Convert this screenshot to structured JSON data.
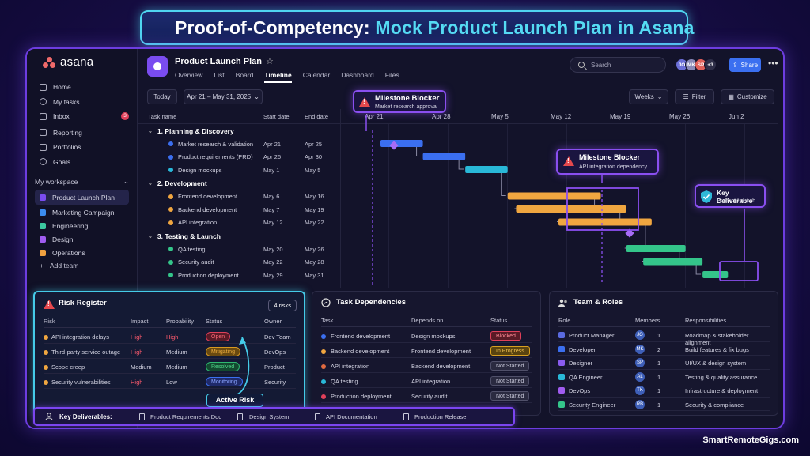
{
  "banner": {
    "title_main": "Proof-of-Competency:",
    "title_accent": "Mock Product Launch Plan in Asana"
  },
  "sidebar": {
    "logo": "asana",
    "nav": [
      {
        "label": "Home",
        "icon": "home-icon"
      },
      {
        "label": "My tasks",
        "icon": "check-icon"
      },
      {
        "label": "Inbox",
        "icon": "bell-icon",
        "badge": "3"
      },
      {
        "label": "Reporting",
        "icon": "chart-icon"
      },
      {
        "label": "Portfolios",
        "icon": "folder-icon"
      },
      {
        "label": "Goals",
        "icon": "target-icon"
      }
    ],
    "workspace_label": "My workspace",
    "projects": [
      {
        "label": "Product Launch Plan",
        "color": "#7a4cf0"
      },
      {
        "label": "Marketing Campaign",
        "color": "#3b8cf0"
      },
      {
        "label": "Engineering",
        "color": "#3cc8a0"
      },
      {
        "label": "Design",
        "color": "#a05cf0"
      },
      {
        "label": "Operations",
        "color": "#f0a040"
      }
    ],
    "add_team": "Add team"
  },
  "header": {
    "project_title": "Product Launch Plan",
    "tabs": [
      "Overview",
      "List",
      "Board",
      "Timeline",
      "Calendar",
      "Dashboard",
      "Files"
    ],
    "active_tab": "Timeline",
    "search_placeholder": "Search",
    "avatars": [
      {
        "initials": "JO",
        "color": "#6b6fd8"
      },
      {
        "initials": "MK",
        "color": "#8a8ab8"
      },
      {
        "initials": "SP",
        "color": "#e0605a"
      }
    ],
    "avatar_more": "+3",
    "share_label": "Share"
  },
  "toolbar": {
    "today": "Today",
    "date_range": "Apr 21 – May 31, 2025",
    "weeks": "Weeks",
    "filter": "Filter",
    "customize": "Customize"
  },
  "task_table": {
    "headers": [
      "Task name",
      "Start date",
      "End date"
    ],
    "sections": [
      {
        "title": "1. Planning & Discovery",
        "tasks": [
          {
            "name": "Market research & validation",
            "start": "Apr 21",
            "end": "Apr 25",
            "color": "#3b6ff0"
          },
          {
            "name": "Product requirements (PRD)",
            "start": "Apr 26",
            "end": "Apr 30",
            "color": "#3b6ff0"
          },
          {
            "name": "Design mockups",
            "start": "May 1",
            "end": "May 5",
            "color": "#29b8d8"
          }
        ]
      },
      {
        "title": "2. Development",
        "tasks": [
          {
            "name": "Frontend development",
            "start": "May 6",
            "end": "May 16",
            "color": "#f0a640"
          },
          {
            "name": "Backend development",
            "start": "May 7",
            "end": "May 19",
            "color": "#f0a640"
          },
          {
            "name": "API integration",
            "start": "May 12",
            "end": "May 22",
            "color": "#f0a640"
          }
        ]
      },
      {
        "title": "3. Testing & Launch",
        "tasks": [
          {
            "name": "QA testing",
            "start": "May 20",
            "end": "May 26",
            "color": "#34c58a"
          },
          {
            "name": "Security audit",
            "start": "May 22",
            "end": "May 28",
            "color": "#34c58a"
          },
          {
            "name": "Production deployment",
            "start": "May 29",
            "end": "May 31",
            "color": "#34c58a"
          }
        ]
      }
    ]
  },
  "timeline": {
    "week_labels": [
      "Apr 21",
      "Apr 28",
      "May 5",
      "May 12",
      "May 19",
      "May 26",
      "Jun 2"
    ],
    "milestone_1": {
      "title": "Milestone Blocker",
      "subtitle": "Market research approval"
    },
    "milestone_2": {
      "title": "Milestone Blocker",
      "subtitle": "API integration dependency"
    },
    "deliverable": {
      "title": "Key Deliverable",
      "subtitle": "Product Launch"
    }
  },
  "risk_register": {
    "title": "Risk Register",
    "count": "4 risks",
    "headers": [
      "Risk",
      "Impact",
      "Probability",
      "Status",
      "Owner"
    ],
    "rows": [
      {
        "risk": "API integration delays",
        "impact": "High",
        "probability": "High",
        "status": "Open",
        "owner": "Dev Team"
      },
      {
        "risk": "Third-party service outage",
        "impact": "High",
        "probability": "Medium",
        "status": "Mitigating",
        "owner": "DevOps"
      },
      {
        "risk": "Scope creep",
        "impact": "Medium",
        "probability": "Medium",
        "status": "Resolved",
        "owner": "Product"
      },
      {
        "risk": "Security vulnerabilities",
        "impact": "High",
        "probability": "Low",
        "status": "Monitoring",
        "owner": "Security"
      }
    ],
    "annotation": "Active Risk"
  },
  "dependencies": {
    "title": "Task Dependencies",
    "headers": [
      "Task",
      "Depends on",
      "Status"
    ],
    "rows": [
      {
        "task": "Frontend development",
        "depends": "Design mockups",
        "status": "Blocked"
      },
      {
        "task": "Backend development",
        "depends": "Frontend development",
        "status": "In Progress"
      },
      {
        "task": "API integration",
        "depends": "Backend development",
        "status": "Not Started"
      },
      {
        "task": "QA testing",
        "depends": "API integration",
        "status": "Not Started"
      },
      {
        "task": "Production deployment",
        "depends": "Security audit",
        "status": "Not Started"
      }
    ]
  },
  "team": {
    "title": "Team & Roles",
    "headers": [
      "Role",
      "Members",
      "Responsibilities"
    ],
    "rows": [
      {
        "role": "Product Manager",
        "initials": "JO",
        "count": "1",
        "resp": "Roadmap & stakeholder alignment"
      },
      {
        "role": "Developer",
        "initials": "MK",
        "count": "2",
        "resp": "Build features & fix bugs"
      },
      {
        "role": "Designer",
        "initials": "SP",
        "count": "1",
        "resp": "UI/UX & design system"
      },
      {
        "role": "QA Engineer",
        "initials": "AL",
        "count": "1",
        "resp": "Testing & quality assurance"
      },
      {
        "role": "DevOps",
        "initials": "TK",
        "count": "1",
        "resp": "Infrastructure & deployment"
      },
      {
        "role": "Security Engineer",
        "initials": "RB",
        "count": "1",
        "resp": "Security & compliance"
      }
    ]
  },
  "deliverables": {
    "label": "Key Deliverables:",
    "items": [
      "Product Requirements Doc",
      "Design System",
      "API Documentation",
      "Production Release"
    ]
  },
  "credit": "SmartRemoteGigs.com"
}
